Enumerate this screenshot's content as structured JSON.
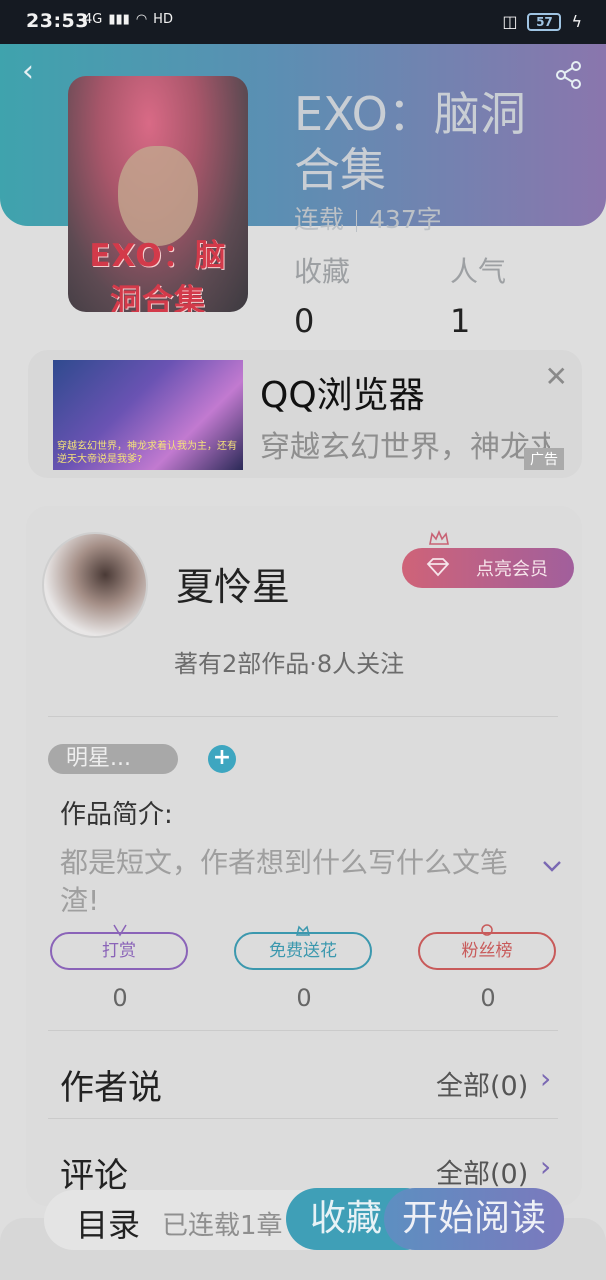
{
  "status_bar": {
    "time": "23:53",
    "network": "4G",
    "wifi": "HD",
    "battery": "57"
  },
  "book": {
    "title": "EXO：脑洞合集",
    "status": "连载",
    "word_count": "437字",
    "cover_text": "EXO：脑洞合集",
    "stats": [
      {
        "label": "收藏",
        "value": "0"
      },
      {
        "label": "人气",
        "value": "1"
      }
    ]
  },
  "ad": {
    "title": "QQ浏览器",
    "description": "穿越玄幻世界，神龙求着认我为主",
    "image_caption": "穿越玄幻世界，神龙求着认我为主，还有逆天大帝说是我爹?",
    "tag": "广告"
  },
  "author": {
    "name": "夏怜星",
    "stats": "著有2部作品·8人关注",
    "vip_label": "点亮会员"
  },
  "tags": {
    "chip": "明星...",
    "add": "+"
  },
  "intro": {
    "label": "作品简介:",
    "text": "都是短文，作者想到什么写什么文笔渣!"
  },
  "actions": [
    {
      "label": "打赏",
      "count": "0",
      "color": "#8a63b8"
    },
    {
      "label": "免费送花",
      "count": "0",
      "color": "#3b98ae"
    },
    {
      "label": "粉丝榜",
      "count": "0",
      "color": "#c85a5a"
    }
  ],
  "sections": {
    "author_says": {
      "label": "作者说",
      "link": "全部(0)"
    },
    "comments": {
      "label": "评论",
      "link": "全部(0)"
    }
  },
  "bottom_bar": {
    "toc_label": "目录",
    "toc_status": "已连载1章",
    "favorite_label": "收藏",
    "read_label": "开始阅读"
  }
}
